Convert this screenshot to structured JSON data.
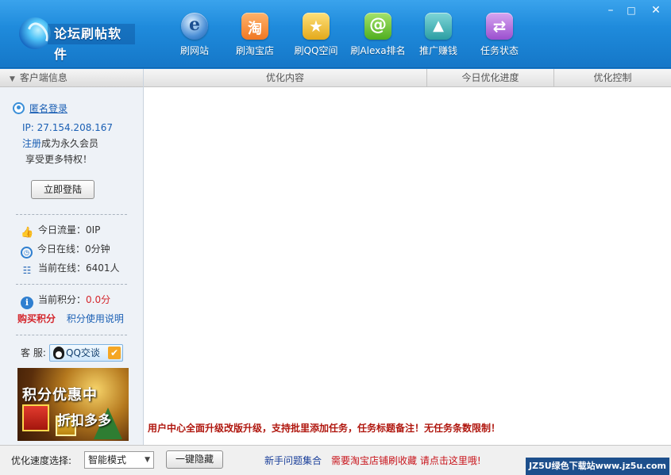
{
  "app": {
    "title": "论坛刷帖软件",
    "window_controls": {
      "minimize": "–",
      "maximize": "□",
      "close": "✕"
    }
  },
  "nav": [
    {
      "label": "刷网站",
      "icon": "ie-globe-icon"
    },
    {
      "label": "刷淘宝店",
      "icon": "taobao-icon"
    },
    {
      "label": "刷QQ空间",
      "icon": "qzone-star-icon"
    },
    {
      "label": "刷Alexa排名",
      "icon": "alexa-at-icon"
    },
    {
      "label": "推广赚钱",
      "icon": "rocket-icon"
    },
    {
      "label": "任务状态",
      "icon": "task-swap-icon"
    }
  ],
  "sidebar": {
    "header": "客户端信息",
    "anon_login": "匿名登录",
    "ip": "IP: 27.154.208.167",
    "register_link": "注册",
    "register_text": "成为永久会员",
    "privilege_text": "享受更多特权！",
    "login_button": "立即登陆",
    "stats": {
      "traffic": "今日流量：0IP",
      "online_time": "今日在线：0分钟",
      "current_online": "当前在线：6401人"
    },
    "points_label": "当前积分：",
    "points_value": "0.0分",
    "buy_points": "购买积分",
    "points_help": "积分使用说明",
    "service_label": "客 服:",
    "qq_chat": "QQ交谈",
    "promo": {
      "line1": "积分优惠中",
      "line2": "折扣多多"
    }
  },
  "table": {
    "columns": [
      "优化内容",
      "今日优化进度",
      "优化控制"
    ]
  },
  "notice": "用户中心全面升级改版升级，支持批里添加任务，任务标题备注！无任务条数限制！",
  "bottom": {
    "speed_label": "优化速度选择:",
    "speed_value": "智能模式",
    "hide_button": "一键隐藏",
    "faq_link": "新手问题集合",
    "taobao_link": "需要淘宝店铺刷收藏  请点击这里哦!",
    "watermark": "JZ5U绿色下载站www.jz5u.com"
  },
  "colors": {
    "titlebar": "#1f8bdc",
    "notice_red": "#b0170f",
    "link_blue": "#1a5fb4",
    "accent_red": "#d4262c"
  }
}
